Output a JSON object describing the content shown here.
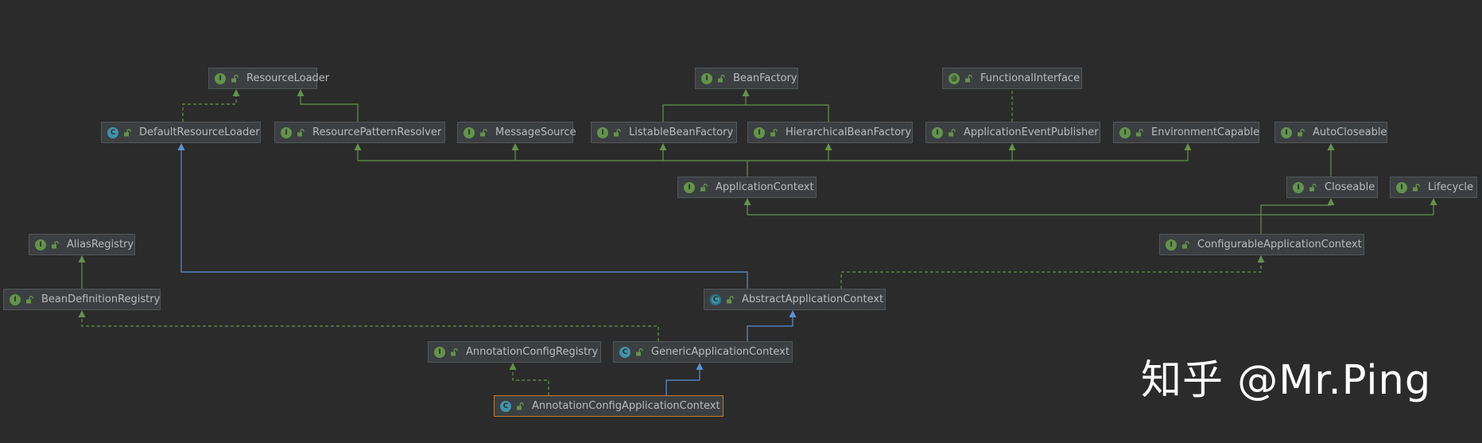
{
  "diagram": {
    "nodes": [
      {
        "id": "resource-loader",
        "name": "ResourceLoader",
        "kind": "interface"
      },
      {
        "id": "bean-factory",
        "name": "BeanFactory",
        "kind": "interface"
      },
      {
        "id": "functional-interface",
        "name": "FunctionalInterface",
        "kind": "annotation"
      },
      {
        "id": "default-resource-loader",
        "name": "DefaultResourceLoader",
        "kind": "class"
      },
      {
        "id": "resource-pattern-resolver",
        "name": "ResourcePatternResolver",
        "kind": "interface"
      },
      {
        "id": "message-source",
        "name": "MessageSource",
        "kind": "interface"
      },
      {
        "id": "listable-bean-factory",
        "name": "ListableBeanFactory",
        "kind": "interface"
      },
      {
        "id": "hierarchical-bean-factory",
        "name": "HierarchicalBeanFactory",
        "kind": "interface"
      },
      {
        "id": "application-event-publisher",
        "name": "ApplicationEventPublisher",
        "kind": "interface"
      },
      {
        "id": "environment-capable",
        "name": "EnvironmentCapable",
        "kind": "interface"
      },
      {
        "id": "auto-closeable",
        "name": "AutoCloseable",
        "kind": "interface"
      },
      {
        "id": "application-context",
        "name": "ApplicationContext",
        "kind": "interface"
      },
      {
        "id": "closeable",
        "name": "Closeable",
        "kind": "interface"
      },
      {
        "id": "lifecycle",
        "name": "Lifecycle",
        "kind": "interface"
      },
      {
        "id": "alias-registry",
        "name": "AliasRegistry",
        "kind": "interface"
      },
      {
        "id": "configurable-application-context",
        "name": "ConfigurableApplicationContext",
        "kind": "interface"
      },
      {
        "id": "bean-definition-registry",
        "name": "BeanDefinitionRegistry",
        "kind": "interface"
      },
      {
        "id": "abstract-application-context",
        "name": "AbstractApplicationContext",
        "kind": "abstract"
      },
      {
        "id": "annotation-config-registry",
        "name": "AnnotationConfigRegistry",
        "kind": "interface"
      },
      {
        "id": "generic-application-context",
        "name": "GenericApplicationContext",
        "kind": "class"
      },
      {
        "id": "annotation-config-application-context",
        "name": "AnnotationConfigApplicationContext",
        "kind": "class",
        "selected": true
      }
    ],
    "edges": [
      {
        "from": "default-resource-loader",
        "to": "resource-loader",
        "type": "implements"
      },
      {
        "from": "resource-pattern-resolver",
        "to": "resource-loader",
        "type": "extends-interface"
      },
      {
        "from": "listable-bean-factory",
        "to": "bean-factory",
        "type": "extends-interface"
      },
      {
        "from": "hierarchical-bean-factory",
        "to": "bean-factory",
        "type": "extends-interface"
      },
      {
        "from": "application-event-publisher",
        "to": "functional-interface",
        "type": "annotated"
      },
      {
        "from": "application-context",
        "to": "resource-pattern-resolver",
        "type": "extends-interface"
      },
      {
        "from": "application-context",
        "to": "message-source",
        "type": "extends-interface"
      },
      {
        "from": "application-context",
        "to": "listable-bean-factory",
        "type": "extends-interface"
      },
      {
        "from": "application-context",
        "to": "hierarchical-bean-factory",
        "type": "extends-interface"
      },
      {
        "from": "application-context",
        "to": "application-event-publisher",
        "type": "extends-interface"
      },
      {
        "from": "application-context",
        "to": "environment-capable",
        "type": "extends-interface"
      },
      {
        "from": "closeable",
        "to": "auto-closeable",
        "type": "extends-interface"
      },
      {
        "from": "configurable-application-context",
        "to": "application-context",
        "type": "extends-interface"
      },
      {
        "from": "configurable-application-context",
        "to": "closeable",
        "type": "extends-interface"
      },
      {
        "from": "configurable-application-context",
        "to": "lifecycle",
        "type": "extends-interface"
      },
      {
        "from": "bean-definition-registry",
        "to": "alias-registry",
        "type": "extends-interface"
      },
      {
        "from": "abstract-application-context",
        "to": "default-resource-loader",
        "type": "extends-class"
      },
      {
        "from": "abstract-application-context",
        "to": "configurable-application-context",
        "type": "implements"
      },
      {
        "from": "generic-application-context",
        "to": "abstract-application-context",
        "type": "extends-class"
      },
      {
        "from": "generic-application-context",
        "to": "bean-definition-registry",
        "type": "implements"
      },
      {
        "from": "annotation-config-application-context",
        "to": "generic-application-context",
        "type": "extends-class"
      },
      {
        "from": "annotation-config-application-context",
        "to": "annotation-config-registry",
        "type": "implements"
      }
    ],
    "colors": {
      "background": "#2b2b2b",
      "node_fill": "#3c3f41",
      "node_border": "#515658",
      "node_text": "#bbbbbb",
      "selected_border": "#c47a2c",
      "interface_badge": "#62934b",
      "class_badge": "#3f94a9",
      "edge_interface": "#62934b",
      "edge_class": "#5b8fd6"
    }
  },
  "watermark": "知乎 @Mr.Ping"
}
